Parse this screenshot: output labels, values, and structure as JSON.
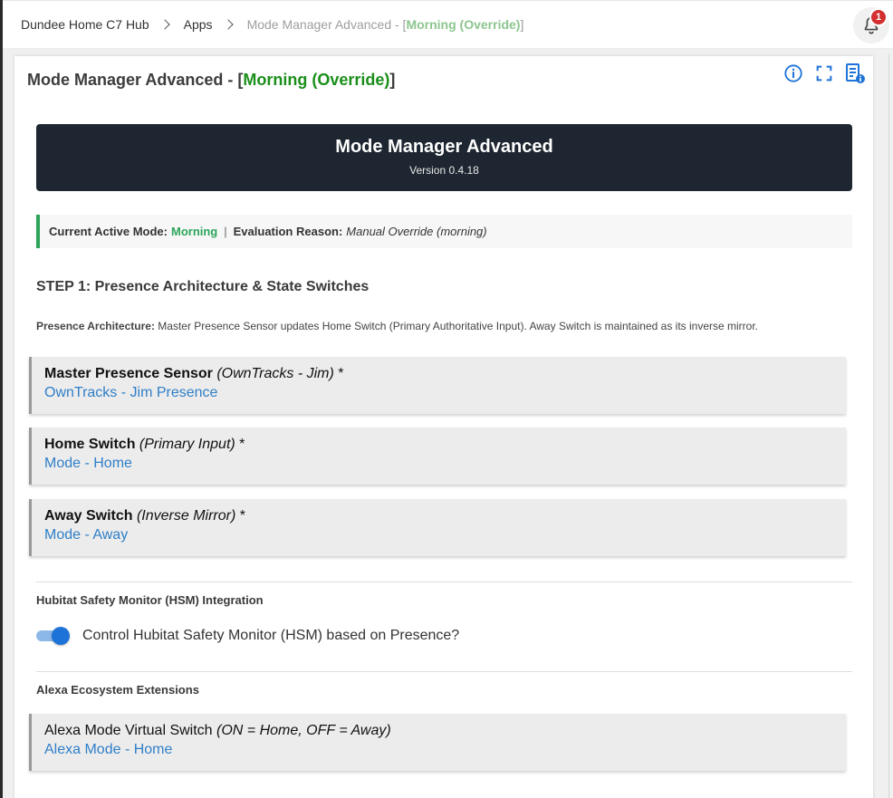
{
  "breadcrumb": {
    "hub": "Dundee Home C7 Hub",
    "apps": "Apps",
    "current_prefix": "Mode Manager Advanced - [",
    "current_mode": "Morning (Override)",
    "current_suffix": "]"
  },
  "notifications": {
    "count": "1"
  },
  "page": {
    "title_prefix": "Mode Manager Advanced - [",
    "title_mode": "Morning (Override)",
    "title_suffix": "]"
  },
  "toolbar_icons": [
    "info-icon",
    "fullscreen-icon",
    "app-info-icon"
  ],
  "banner": {
    "title": "Mode Manager Advanced",
    "version": "Version 0.4.18"
  },
  "status": {
    "mode_label": "Current Active Mode:",
    "mode_value": "Morning",
    "separator": "|",
    "reason_label": "Evaluation Reason:",
    "reason_value": "Manual Override (morning)"
  },
  "step1": {
    "heading": "STEP 1: Presence Architecture & State Switches",
    "desc_label": "Presence Architecture:",
    "desc_text": "Master Presence Sensor updates Home Switch (Primary Authoritative Input). Away Switch is maintained as its inverse mirror."
  },
  "inputs": [
    {
      "label": "Master Presence Sensor",
      "note": "(OwnTracks - Jim)",
      "required": "*",
      "value": "OwnTracks - Jim Presence"
    },
    {
      "label": "Home Switch",
      "note": "(Primary Input)",
      "required": "*",
      "value": "Mode - Home"
    },
    {
      "label": "Away Switch",
      "note": "(Inverse Mirror)",
      "required": "*",
      "value": "Mode - Away"
    }
  ],
  "hsm": {
    "heading": "Hubitat Safety Monitor (HSM) Integration",
    "toggle_label": "Control Hubitat Safety Monitor (HSM) based on Presence?",
    "toggle_on": true
  },
  "alexa": {
    "heading": "Alexa Ecosystem Extensions",
    "label": "Alexa Mode Virtual Switch",
    "note": "(ON = Home, OFF = Away)",
    "value": "Alexa Mode - Home"
  },
  "colors": {
    "accent_green": "#1a8f1a",
    "status_green": "#2ca55a",
    "link_blue": "#2f7fc8",
    "banner_bg": "#1e2731",
    "badge_red": "#d32f2f"
  }
}
